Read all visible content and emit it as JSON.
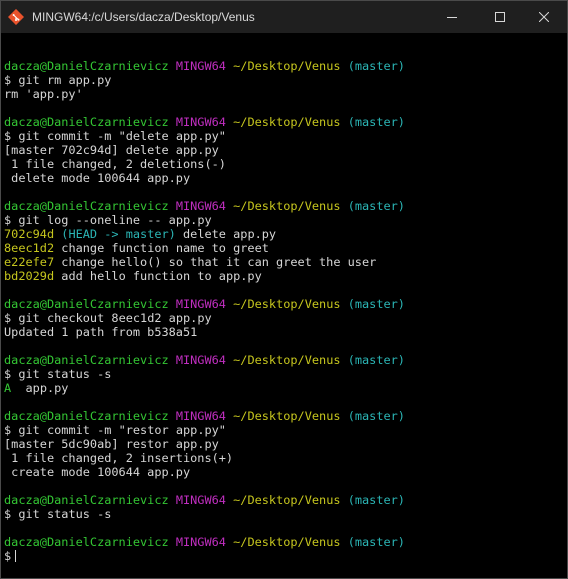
{
  "window": {
    "title": "MINGW64:/c/Users/dacza/Desktop/Venus",
    "app_icon": "git-bash-icon",
    "controls": [
      "minimize-icon",
      "maximize-icon",
      "close-icon"
    ]
  },
  "prompt": {
    "user_host": "dacza@DanielCzarnievicz",
    "system": "MINGW64",
    "path": "~/Desktop/Venus",
    "branch": "(master)",
    "symbol": "$"
  },
  "colors": {
    "user_host": "#34c734",
    "system": "#c02ec0",
    "path": "#c6c61e",
    "branch": "#2bb5b5",
    "text": "#d6d6d6",
    "background": "#000000"
  },
  "terminal": {
    "blocks": [
      {
        "command": "git rm app.py",
        "output": [
          "rm 'app.py'"
        ]
      },
      {
        "command": "git commit -m \"delete app.py\"",
        "output": [
          "[master 702c94d] delete app.py",
          " 1 file changed, 2 deletions(-)",
          " delete mode 100644 app.py"
        ]
      },
      {
        "command": "git log --oneline -- app.py",
        "log": [
          {
            "hash": "702c94d",
            "ref": "(HEAD -> master)",
            "message": "delete app.py"
          },
          {
            "hash": "8eec1d2",
            "ref": "",
            "message": "change function name to greet"
          },
          {
            "hash": "e22efe7",
            "ref": "",
            "message": "change hello() so that it can greet the user"
          },
          {
            "hash": "bd2029d",
            "ref": "",
            "message": "add hello function to app.py"
          }
        ]
      },
      {
        "command": "git checkout 8eec1d2 app.py",
        "output": [
          "Updated 1 path from b538a51"
        ]
      },
      {
        "command": "git status -s",
        "status": {
          "flag": "A",
          "file": "app.py"
        }
      },
      {
        "command": "git commit -m \"restor app.py\"",
        "output": [
          "[master 5dc90ab] restor app.py",
          " 1 file changed, 2 insertions(+)",
          " create mode 100644 app.py"
        ]
      },
      {
        "command": "git status -s",
        "output": []
      }
    ]
  }
}
